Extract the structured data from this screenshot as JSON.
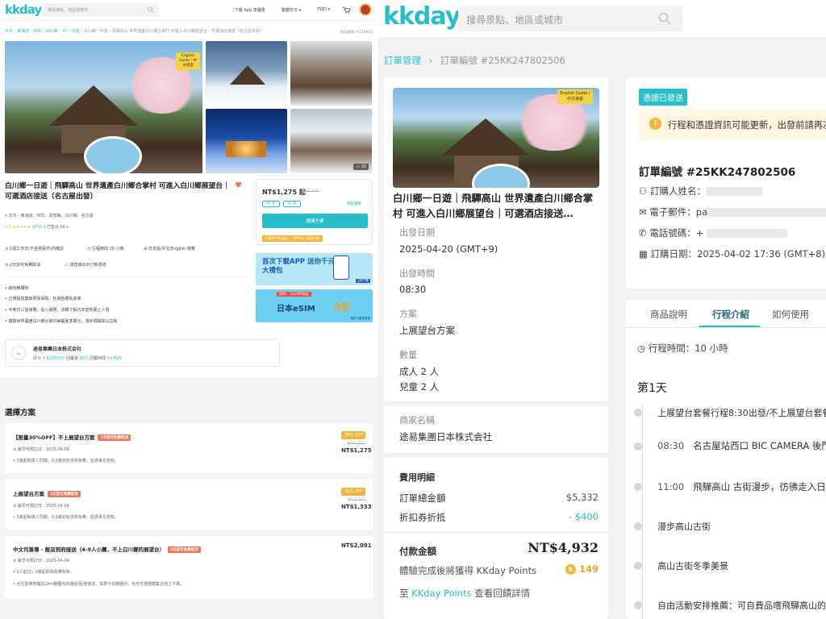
{
  "left": {
    "logo": "kkday",
    "search_placeholder": "搜尋景點、地區或城市",
    "nav": {
      "download": "下載 App 享優惠",
      "lang": "繁體中文",
      "currency": "TWD"
    },
    "breadcrumb": [
      "日本",
      "東海道",
      "岐阜",
      "白川鄉",
      "半/一日遊",
      "白川鄉一日遊｜飛驒高山 世界遺產白川鄉合掌村 可進入白川鄉展望台｜可選酒店接送（名古屋出發）"
    ],
    "breadcrumb_right": "商品編號 #133964",
    "gallery_count": "30",
    "gallery_badge": "English Guide / 中文導遊",
    "title": "白川鄉一日遊｜飛驒高山 世界遺產白川鄉合掌村 可進入白川鄉展望台｜可選酒店接送（名古屋出發）",
    "location": "日本 - 東海道，岐阜，愛知縣，白川鄉，名古屋",
    "rating": "4.6",
    "stars": "★★★★★",
    "reviews": "(974)",
    "booked": "已售出 5K+",
    "features": [
      "1個工作日(不含例假日)內確認",
      "行程時間 10 小時",
      "日本語/中文/English 導覽",
      "2天前可免費取消",
      "請直接出示訂單憑證"
    ],
    "price": "NT$1,275 起",
    "orig_price": "NT$1,831",
    "tag1": "95 折",
    "tag2": "95 折",
    "coupon_link": "領取優惠",
    "select_btn": "選擇方案",
    "promo_small": "下載APP會員輸入「APP95」優惠95折",
    "banner1": "首次下載APP 送你千元大禮包",
    "banner1_sub": "立即下載",
    "banner2_top": "限時！ 日本APP限定",
    "banner2_main": "日本eSIM",
    "banner2_pct": "5折",
    "banner2_sub": "現在下載享優惠",
    "highlights": [
      "純玩無購物",
      "正規提營業執照與保險，杜絕自聘私家車",
      "中英日三語導覽，貼心服務，詳細了解日本當地風土人情",
      "體驗世界遺產白川鄉合掌村美麗夏季風光，漫步飛驒高山古街"
    ],
    "supplier_name": "途易集團日本株式会社",
    "supplier_rating_prefix": "評分",
    "supplier_rating": "4.6(10560)",
    "supplier_reply_prefix": "回覆率",
    "supplier_reply": "96%",
    "supplier_time_prefix": "回覆時間",
    "supplier_time": "4小時內",
    "plans_title": "選擇方案",
    "plans": [
      {
        "name": "【限量30%OFF】不上展望台方案",
        "badge": "2天前可免費取消",
        "date": "最早可預訂日：2025-04-04",
        "note": "3歲起和成人同價，0-2歲幼兒憑票免費，並請事先告知。",
        "off": "30% OFF",
        "orig": "NT$1,831",
        "price": "NT$1,275"
      },
      {
        "name": "上展望台方案",
        "badge": "2天前可免費取消",
        "date": "最早可預訂日：2025-04-04",
        "note": "3歲起和成人同價，0-2歲幼兒憑票免費，並請事先告知。",
        "off": "31% OFF",
        "orig": "NT$1,943",
        "price": "NT$1,333"
      },
      {
        "name": "中文司兼導 - 飯店到府接送（4-9人小團，不上白川鄉的展望台）",
        "badge": "2天前可免費取消",
        "date": "最早可預訂日：2025-04-04",
        "note": "2人起訂；0歲起即為收費對象。",
        "note2": "名古屋榮地鐵站2km範圍內的飯店/民宿接送。如果不在範圍內，也可安排團體集合地上下車。",
        "price": "NT$2,091"
      }
    ]
  },
  "right": {
    "logo": "kkday",
    "search_placeholder": "搜尋景點、地區或城市",
    "breadcrumb": [
      "訂單管理",
      "訂單編號 #25KK247802506"
    ],
    "product_title": "白川鄉一日遊｜飛驒高山 世界遺產白川鄉合掌村 可進入白川鄉展望台｜可選酒店接送…",
    "thumb_badge": "English Guide / 中文導遊",
    "fields": [
      {
        "label": "出發日期",
        "value": "2025-04-20 (GMT+9)"
      },
      {
        "label": "出發時間",
        "value": "08:30"
      },
      {
        "label": "方案",
        "value": "上展望台方案"
      },
      {
        "label": "數量",
        "value": "成人 2 人"
      },
      {
        "label": "",
        "value": "兒童 2 人"
      }
    ],
    "supplier_label": "商家名稱",
    "supplier": "途易集團日本株式会社",
    "fee_title": "費用明細",
    "total_label": "訂單總金額",
    "total": "$5,332",
    "discount_label": "折扣券折抵",
    "discount": "- $400",
    "pay_label": "付款金額",
    "pay": "NT$4,932",
    "points_text": "體驗完成後將獲得 KKday Points",
    "points": "149",
    "points_prefix": "至",
    "points_link": "KKday Points",
    "points_suffix": "查看回饋詳情",
    "status_badge": "憑證已發送",
    "alert": "行程和憑證資訊可能更新，出發前請再次",
    "order_no": "訂單編號 #25KK247802506",
    "orderer_label": "訂購人姓名：",
    "email_label": "電子郵件：",
    "email_value": "pa",
    "phone_label": "電話號碼：",
    "phone_value": "+",
    "date_label": "訂購日期：",
    "date_value": "2025-04-02 17:36 (GMT+8)",
    "tabs": [
      "商品說明",
      "行程介紹",
      "如何使用"
    ],
    "duration": "行程時間：10 小時",
    "day": "第1天",
    "timeline": [
      {
        "time": "",
        "text": "上展望台套餐行程8:30出發/不上展望台套餐"
      },
      {
        "time": "08:30",
        "text": "名古屋站西口 BIC CAMERA 後門的"
      },
      {
        "time": "11:00",
        "text": "飛驒高山 古街漫步，彷彿走入日本"
      },
      {
        "time": "",
        "text": "漫步高山古街"
      },
      {
        "time": "",
        "text": "高山古街冬季美景"
      },
      {
        "time": "",
        "text": "自由活動安排推薦：可自費品嚐飛驒高山的"
      }
    ]
  }
}
